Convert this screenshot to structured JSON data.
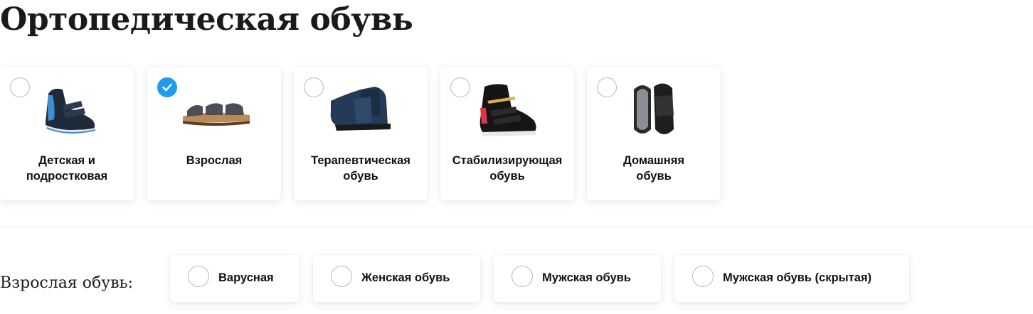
{
  "page_title": "Ортопедическая обувь",
  "categories": [
    {
      "label": "Детская и подростковая",
      "line1": "Детская и",
      "line2": "подростковая",
      "selected": false,
      "icon": "kids-shoe-icon"
    },
    {
      "label": "Взрослая",
      "line1": "Взрослая",
      "line2": "",
      "selected": true,
      "icon": "sandal-icon"
    },
    {
      "label": "Терапевтическая обувь",
      "line1": "Терапевтическая",
      "line2": "обувь",
      "selected": false,
      "icon": "therapeutic-shoe-icon"
    },
    {
      "label": "Стабилизирующая обувь",
      "line1": "Стабилизирующая",
      "line2": "обувь",
      "selected": false,
      "icon": "stabilizing-boot-icon"
    },
    {
      "label": "Домашняя обувь",
      "line1": "Домашняя",
      "line2": "обувь",
      "selected": false,
      "icon": "slippers-icon"
    }
  ],
  "subsection": {
    "heading": "Взрослая обувь:",
    "options": [
      {
        "label": "Варусная",
        "selected": false
      },
      {
        "label": "Женская обувь",
        "selected": false
      },
      {
        "label": "Мужская обувь",
        "selected": false
      },
      {
        "label": "Мужская обувь (скрытая)",
        "selected": false
      }
    ]
  },
  "colors": {
    "accent": "#1e9cf0",
    "radio_border": "#b9b9b9",
    "divider": "#e4e4e4"
  }
}
